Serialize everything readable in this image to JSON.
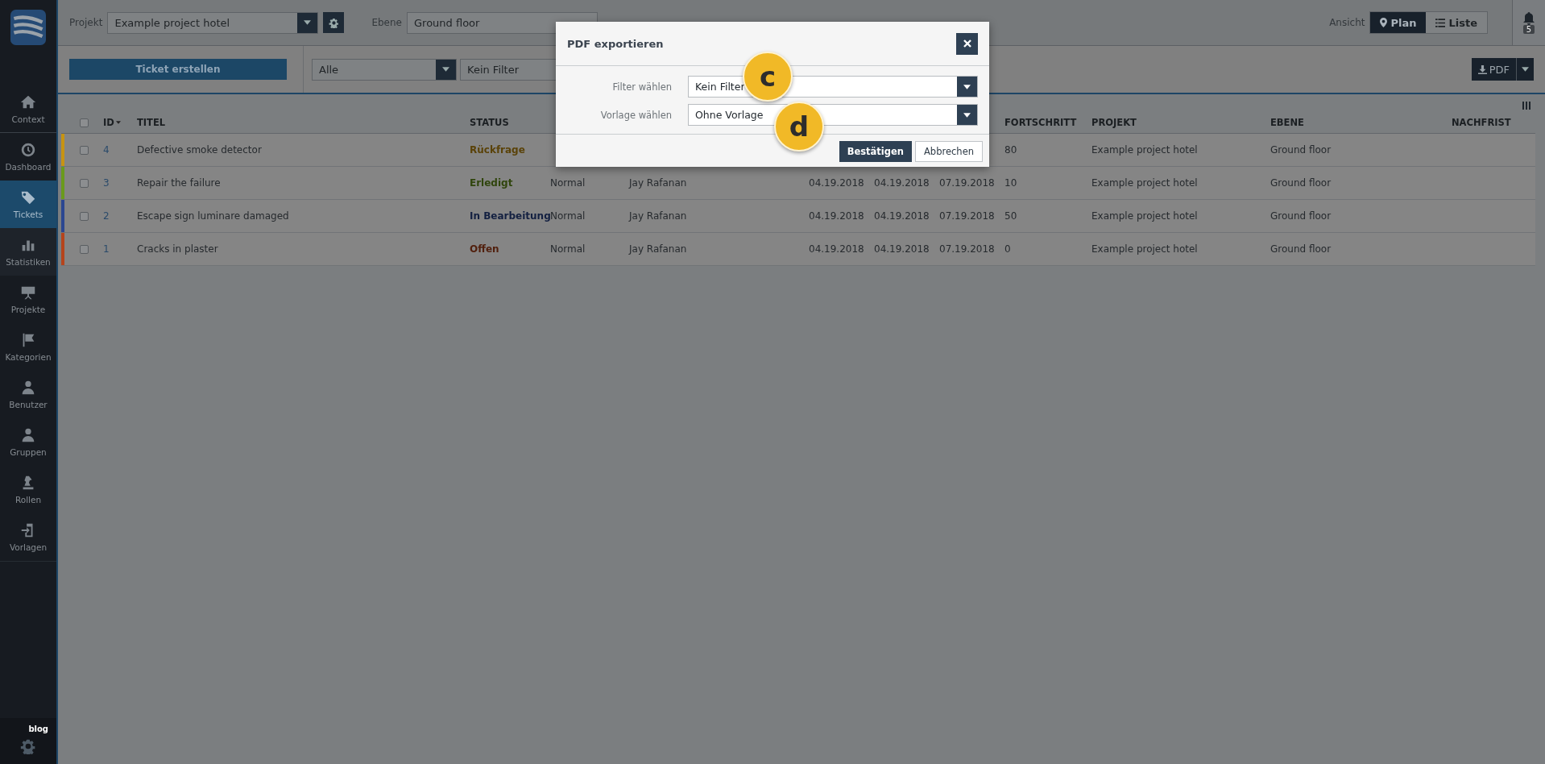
{
  "sidebar": {
    "items": [
      {
        "label": "Context",
        "selected": false
      },
      {
        "label": "Dashboard",
        "selected": false
      },
      {
        "label": "Tickets",
        "selected": true
      },
      {
        "label": "Statistiken",
        "selected": false
      },
      {
        "label": "Projekte",
        "selected": false
      },
      {
        "label": "Kategorien",
        "selected": false
      },
      {
        "label": "Benutzer",
        "selected": false
      },
      {
        "label": "Gruppen",
        "selected": false
      },
      {
        "label": "Rollen",
        "selected": false
      },
      {
        "label": "Vorlagen",
        "selected": false
      }
    ],
    "footer_link": "blog"
  },
  "top_bar": {
    "project_label": "Projekt",
    "project": "Example project hotel",
    "floor_label": "Ebene",
    "floor": "Ground floor",
    "view_label": "Ansicht",
    "views": [
      {
        "label": "Plan",
        "selected": true
      },
      {
        "label": "Liste",
        "selected": false
      }
    ],
    "notification_count": "5"
  },
  "toolbar": {
    "create_button": "Ticket erstellen",
    "scope": "Alle",
    "filter": "Kein Filter",
    "export_button": "PDF"
  },
  "table": {
    "header_checked": false,
    "columns": [
      "ID",
      "TITEL",
      "STATUS",
      "FORTSCHRITT",
      "PROJEKT",
      "EBENE",
      "NACHFRIST"
    ],
    "rows": [
      {
        "checked": false,
        "color": "#c79312",
        "id": "4",
        "title": "Defective smoke detector",
        "status": "Rückfrage",
        "progress": "80",
        "project": "Example project hotel",
        "floor": "Ground floor"
      },
      {
        "checked": false,
        "color": "#6a9a1c",
        "id": "3",
        "title": "Repair the failure",
        "status": "Erledigt",
        "priority": "Normal",
        "assignee": "Jay Rafanan",
        "date_1": "04.19.2018",
        "date_2": "04.19.2018",
        "date_3": "07.19.2018",
        "progress": "10",
        "project": "Example project hotel",
        "floor": "Ground floor"
      },
      {
        "checked": false,
        "color": "#2b4791",
        "id": "2",
        "title": "Escape sign luminare damaged",
        "status": "In Bearbeitung",
        "priority": "Normal",
        "assignee": "Jay Rafanan",
        "date_1": "04.19.2018",
        "date_2": "04.19.2018",
        "date_3": "07.19.2018",
        "progress": "50",
        "project": "Example project hotel",
        "floor": "Ground floor"
      },
      {
        "checked": false,
        "color": "#b5441c",
        "id": "1",
        "title": "Cracks in plaster",
        "status": "Offen",
        "priority": "Normal",
        "assignee": "Jay Rafanan",
        "date_1": "04.19.2018",
        "date_2": "04.19.2018",
        "date_3": "07.19.2018",
        "progress": "0",
        "project": "Example project hotel",
        "floor": "Ground floor"
      }
    ]
  },
  "dialog": {
    "title": "PDF exportieren",
    "fields": [
      {
        "label": "Filter wählen",
        "value": "Kein Filter"
      },
      {
        "label": "Vorlage wählen",
        "value": "Ohne Vorlage"
      }
    ],
    "confirm_button": "Bestätigen",
    "cancel_button": "Abbrechen"
  },
  "callouts": [
    "c",
    "d"
  ]
}
